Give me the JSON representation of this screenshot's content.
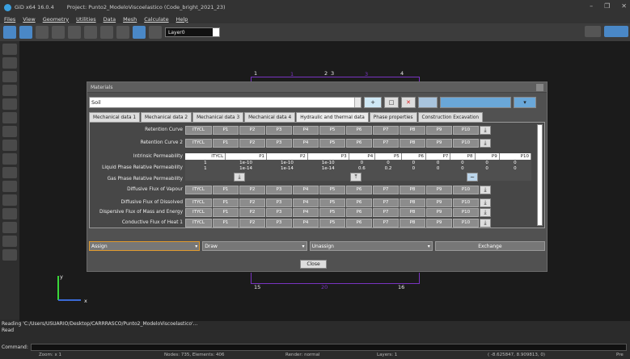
{
  "app": {
    "name": "GiD x64 16.0.4",
    "project": "Project: Punto2_ModeloViscoelastico (Code_bright_2021_23)"
  },
  "menu": [
    "Files",
    "View",
    "Geometry",
    "Utilities",
    "Data",
    "Mesh",
    "Calculate",
    "Help"
  ],
  "toolbar": {
    "layer_value": "Layer0"
  },
  "canvas": {
    "top_labels": [
      "1",
      "1",
      "2",
      "3",
      "3",
      "4"
    ],
    "bottom_labels": [
      "15",
      "20",
      "16"
    ],
    "axis_y": "y",
    "axis_x": "x"
  },
  "dialog": {
    "title": "Materials",
    "material_value": "Soil",
    "tabs": [
      "Mechanical data 1",
      "Mechanical data 2",
      "Mechanical data 3",
      "Mechanical data 4",
      "Hydraulic and thermal data",
      "Phase properties",
      "Construction Excavation"
    ],
    "active_tab": "Hydraulic and thermal data",
    "params": [
      "ITYCL",
      "P1",
      "P2",
      "P3",
      "P4",
      "P5",
      "P6",
      "P7",
      "P8",
      "P9",
      "P10"
    ],
    "rows_top": [
      "Retention Curve",
      "Retention Curve 2"
    ],
    "rows_mid": [
      "Intrinsic Permeability",
      "Liquid Phase Relative Permeability",
      "Gas Phase Relative Permeability"
    ],
    "rows_bottom": [
      "Diffusive Flux of Vapour",
      "Diffusive Flux of Dissolved",
      "Dispersive Flux of Mass and Energy",
      "Conductive Flux of Heat 1"
    ],
    "table": {
      "headers": [
        "ITYCL",
        "P1",
        "P2",
        "P3",
        "P4",
        "P5",
        "P6",
        "P7",
        "P8",
        "P9",
        "P10"
      ],
      "rows": [
        [
          "1",
          "1e-10",
          "1e-10",
          "1e-10",
          "0",
          "0",
          "0",
          "0",
          "0",
          "0",
          "0"
        ],
        [
          "1",
          "1e-14",
          "1e-14",
          "1e-14",
          "0.6",
          "0.2",
          "0",
          "0",
          "0",
          "0",
          "0"
        ]
      ]
    },
    "assign_label": "Assign",
    "draw_label": "Draw",
    "unassign_label": "Unassign",
    "exchange_label": "Exchange",
    "close_label": "Close"
  },
  "status": {
    "reading": "Reading 'C:/Users/USUARIO/Desktop/CARRRASCO/Punto2_ModeloViscoelastico'...",
    "read": "Read",
    "command_label": "Command:",
    "zoom": "Zoom: x 1",
    "nodes": "Nodes: 735, Elements: 406",
    "render": "Render: normal",
    "layers": "Layers: 1",
    "coords": "( -8.625847, 8.909813, 0)",
    "pre": "Pre"
  },
  "colors": {
    "frame": "#7a34c2",
    "accent": "#3aa0e0",
    "assign_border": "#e09a2e"
  }
}
